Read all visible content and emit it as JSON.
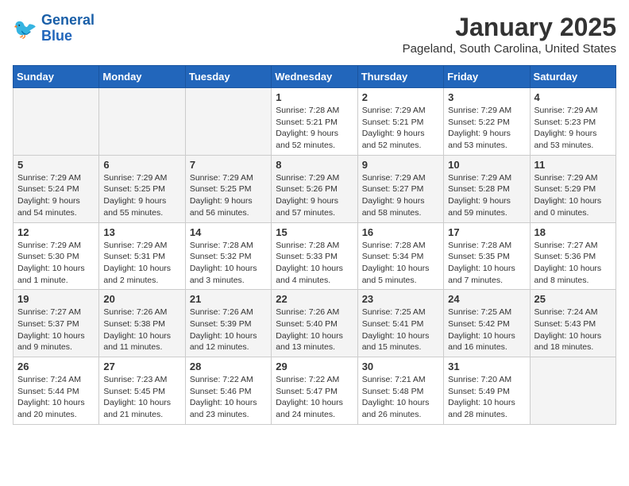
{
  "header": {
    "logo_line1": "General",
    "logo_line2": "Blue",
    "title": "January 2025",
    "subtitle": "Pageland, South Carolina, United States"
  },
  "weekdays": [
    "Sunday",
    "Monday",
    "Tuesday",
    "Wednesday",
    "Thursday",
    "Friday",
    "Saturday"
  ],
  "weeks": [
    [
      {
        "day": "",
        "info": ""
      },
      {
        "day": "",
        "info": ""
      },
      {
        "day": "",
        "info": ""
      },
      {
        "day": "1",
        "info": "Sunrise: 7:28 AM\nSunset: 5:21 PM\nDaylight: 9 hours and 52 minutes."
      },
      {
        "day": "2",
        "info": "Sunrise: 7:29 AM\nSunset: 5:21 PM\nDaylight: 9 hours and 52 minutes."
      },
      {
        "day": "3",
        "info": "Sunrise: 7:29 AM\nSunset: 5:22 PM\nDaylight: 9 hours and 53 minutes."
      },
      {
        "day": "4",
        "info": "Sunrise: 7:29 AM\nSunset: 5:23 PM\nDaylight: 9 hours and 53 minutes."
      }
    ],
    [
      {
        "day": "5",
        "info": "Sunrise: 7:29 AM\nSunset: 5:24 PM\nDaylight: 9 hours and 54 minutes."
      },
      {
        "day": "6",
        "info": "Sunrise: 7:29 AM\nSunset: 5:25 PM\nDaylight: 9 hours and 55 minutes."
      },
      {
        "day": "7",
        "info": "Sunrise: 7:29 AM\nSunset: 5:25 PM\nDaylight: 9 hours and 56 minutes."
      },
      {
        "day": "8",
        "info": "Sunrise: 7:29 AM\nSunset: 5:26 PM\nDaylight: 9 hours and 57 minutes."
      },
      {
        "day": "9",
        "info": "Sunrise: 7:29 AM\nSunset: 5:27 PM\nDaylight: 9 hours and 58 minutes."
      },
      {
        "day": "10",
        "info": "Sunrise: 7:29 AM\nSunset: 5:28 PM\nDaylight: 9 hours and 59 minutes."
      },
      {
        "day": "11",
        "info": "Sunrise: 7:29 AM\nSunset: 5:29 PM\nDaylight: 10 hours and 0 minutes."
      }
    ],
    [
      {
        "day": "12",
        "info": "Sunrise: 7:29 AM\nSunset: 5:30 PM\nDaylight: 10 hours and 1 minute."
      },
      {
        "day": "13",
        "info": "Sunrise: 7:29 AM\nSunset: 5:31 PM\nDaylight: 10 hours and 2 minutes."
      },
      {
        "day": "14",
        "info": "Sunrise: 7:28 AM\nSunset: 5:32 PM\nDaylight: 10 hours and 3 minutes."
      },
      {
        "day": "15",
        "info": "Sunrise: 7:28 AM\nSunset: 5:33 PM\nDaylight: 10 hours and 4 minutes."
      },
      {
        "day": "16",
        "info": "Sunrise: 7:28 AM\nSunset: 5:34 PM\nDaylight: 10 hours and 5 minutes."
      },
      {
        "day": "17",
        "info": "Sunrise: 7:28 AM\nSunset: 5:35 PM\nDaylight: 10 hours and 7 minutes."
      },
      {
        "day": "18",
        "info": "Sunrise: 7:27 AM\nSunset: 5:36 PM\nDaylight: 10 hours and 8 minutes."
      }
    ],
    [
      {
        "day": "19",
        "info": "Sunrise: 7:27 AM\nSunset: 5:37 PM\nDaylight: 10 hours and 9 minutes."
      },
      {
        "day": "20",
        "info": "Sunrise: 7:26 AM\nSunset: 5:38 PM\nDaylight: 10 hours and 11 minutes."
      },
      {
        "day": "21",
        "info": "Sunrise: 7:26 AM\nSunset: 5:39 PM\nDaylight: 10 hours and 12 minutes."
      },
      {
        "day": "22",
        "info": "Sunrise: 7:26 AM\nSunset: 5:40 PM\nDaylight: 10 hours and 13 minutes."
      },
      {
        "day": "23",
        "info": "Sunrise: 7:25 AM\nSunset: 5:41 PM\nDaylight: 10 hours and 15 minutes."
      },
      {
        "day": "24",
        "info": "Sunrise: 7:25 AM\nSunset: 5:42 PM\nDaylight: 10 hours and 16 minutes."
      },
      {
        "day": "25",
        "info": "Sunrise: 7:24 AM\nSunset: 5:43 PM\nDaylight: 10 hours and 18 minutes."
      }
    ],
    [
      {
        "day": "26",
        "info": "Sunrise: 7:24 AM\nSunset: 5:44 PM\nDaylight: 10 hours and 20 minutes."
      },
      {
        "day": "27",
        "info": "Sunrise: 7:23 AM\nSunset: 5:45 PM\nDaylight: 10 hours and 21 minutes."
      },
      {
        "day": "28",
        "info": "Sunrise: 7:22 AM\nSunset: 5:46 PM\nDaylight: 10 hours and 23 minutes."
      },
      {
        "day": "29",
        "info": "Sunrise: 7:22 AM\nSunset: 5:47 PM\nDaylight: 10 hours and 24 minutes."
      },
      {
        "day": "30",
        "info": "Sunrise: 7:21 AM\nSunset: 5:48 PM\nDaylight: 10 hours and 26 minutes."
      },
      {
        "day": "31",
        "info": "Sunrise: 7:20 AM\nSunset: 5:49 PM\nDaylight: 10 hours and 28 minutes."
      },
      {
        "day": "",
        "info": ""
      }
    ]
  ]
}
